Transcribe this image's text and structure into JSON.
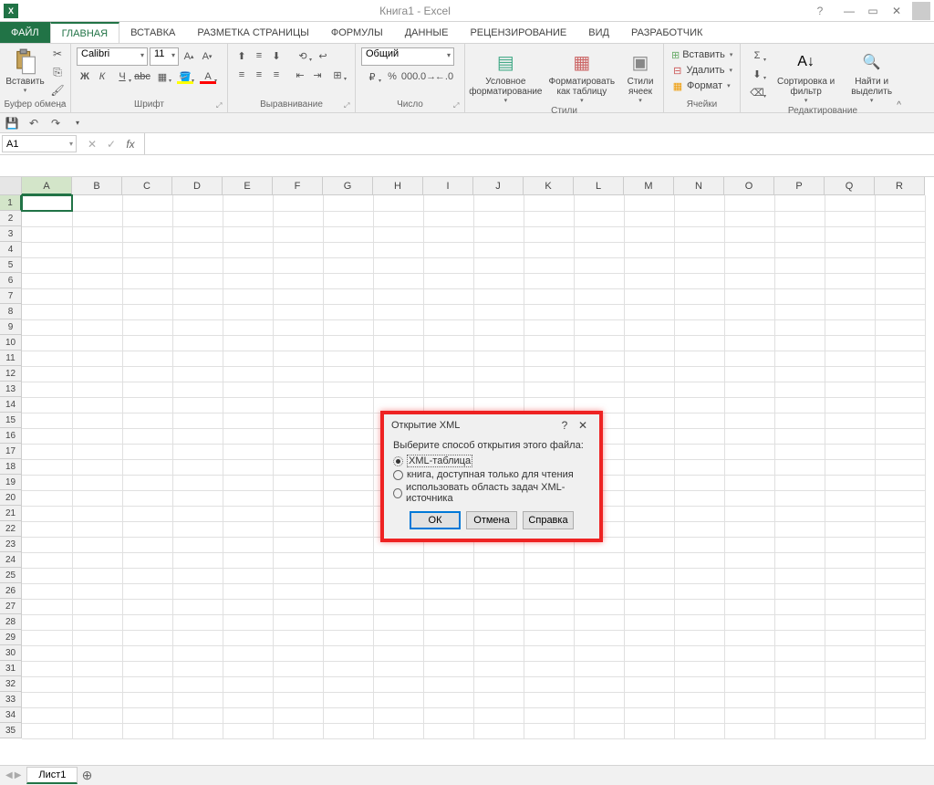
{
  "titlebar": {
    "title": "Книга1 - Excel"
  },
  "tabs": {
    "file": "ФАЙЛ",
    "home": "ГЛАВНАЯ",
    "insert": "ВСТАВКА",
    "pagelayout": "РАЗМЕТКА СТРАНИЦЫ",
    "formulas": "ФОРМУЛЫ",
    "data": "ДАННЫЕ",
    "review": "РЕЦЕНЗИРОВАНИЕ",
    "view": "ВИД",
    "developer": "РАЗРАБОТЧИК"
  },
  "ribbon": {
    "clipboard": {
      "label": "Буфер обмена",
      "paste": "Вставить"
    },
    "font": {
      "label": "Шрифт",
      "name": "Calibri",
      "size": "11",
      "bold": "Ж",
      "italic": "К",
      "underline": "Ч"
    },
    "alignment": {
      "label": "Выравнивание"
    },
    "number": {
      "label": "Число",
      "format": "Общий"
    },
    "styles": {
      "label": "Стили",
      "conditional": "Условное форматирование",
      "table": "Форматировать как таблицу",
      "cell": "Стили ячеек"
    },
    "cells": {
      "label": "Ячейки",
      "insert": "Вставить",
      "delete": "Удалить",
      "format": "Формат"
    },
    "editing": {
      "label": "Редактирование",
      "sort": "Сортировка и фильтр",
      "find": "Найти и выделить"
    }
  },
  "namebox": "A1",
  "sheet": {
    "name": "Лист1"
  },
  "columns": [
    "A",
    "B",
    "C",
    "D",
    "E",
    "F",
    "G",
    "H",
    "I",
    "J",
    "K",
    "L",
    "M",
    "N",
    "O",
    "P",
    "Q",
    "R"
  ],
  "rows": [
    "1",
    "2",
    "3",
    "4",
    "5",
    "6",
    "7",
    "8",
    "9",
    "10",
    "11",
    "12",
    "13",
    "14",
    "15",
    "16",
    "17",
    "18",
    "19",
    "20",
    "21",
    "22",
    "23",
    "24",
    "25",
    "26",
    "27",
    "28",
    "29",
    "30",
    "31",
    "32",
    "33",
    "34",
    "35"
  ],
  "dialog": {
    "title": "Открытие XML",
    "message": "Выберите способ открытия этого файла:",
    "opt1": "XML-таблица",
    "opt2": "книга, доступная только для чтения",
    "opt3": "использовать область задач XML-источника",
    "ok": "ОК",
    "cancel": "Отмена",
    "help": "Справка"
  }
}
